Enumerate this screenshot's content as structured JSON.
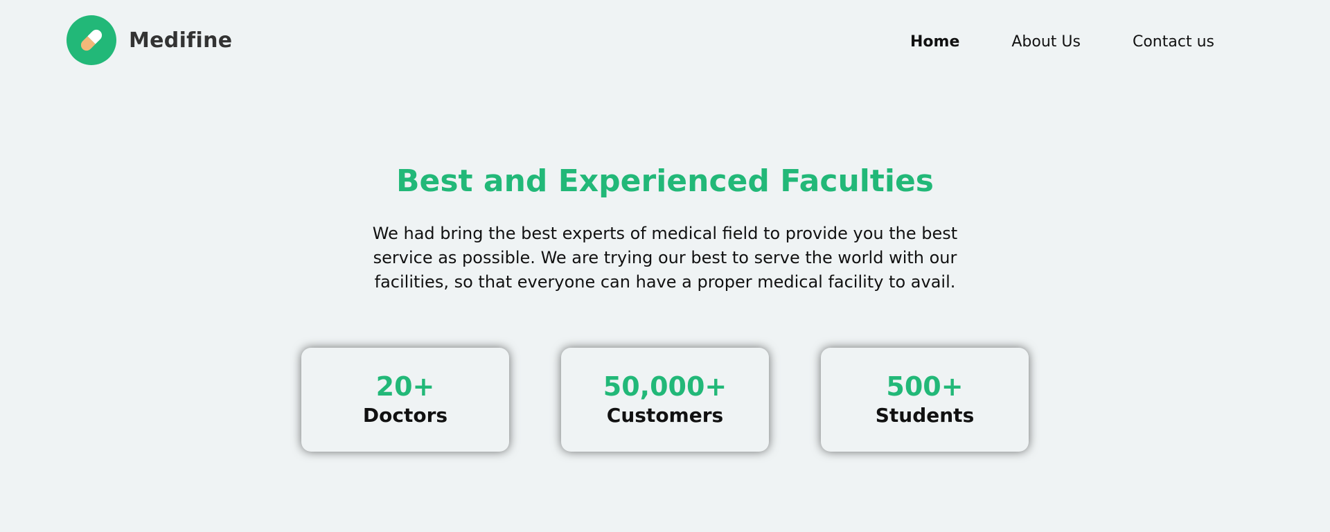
{
  "brand": {
    "name": "Medifine",
    "logo_icon": "pill-icon",
    "accent_color": "#22b878"
  },
  "nav": {
    "items": [
      {
        "label": "Home",
        "active": true
      },
      {
        "label": "About Us",
        "active": false
      },
      {
        "label": "Contact us",
        "active": false
      }
    ]
  },
  "hero": {
    "title": "Best and Experienced Faculties",
    "description": "We had bring the best experts of medical field to provide you the best service as possible. We are trying our best to serve the world with our facilities, so that everyone can have a proper medical facility to avail."
  },
  "stats": [
    {
      "value": "20+",
      "label": "Doctors"
    },
    {
      "value": "50,000+",
      "label": "Customers"
    },
    {
      "value": "500+",
      "label": "Students"
    }
  ]
}
